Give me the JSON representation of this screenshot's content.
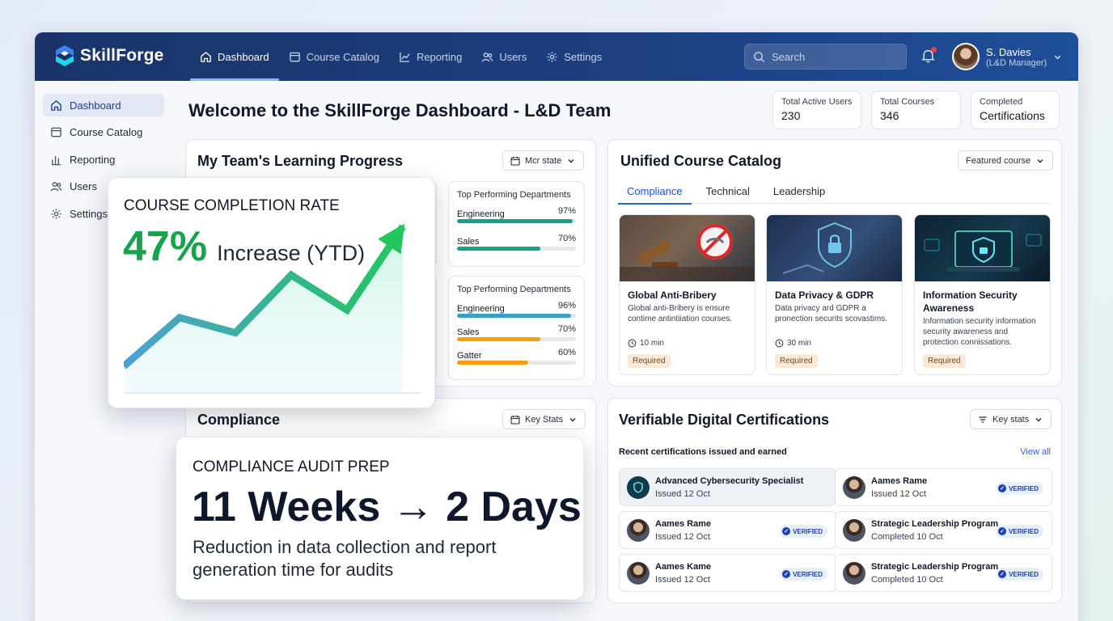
{
  "app": {
    "name": "SkillForge"
  },
  "nav": [
    {
      "label": "Dashboard",
      "icon": "home-icon"
    },
    {
      "label": "Course Catalog",
      "icon": "catalog-icon"
    },
    {
      "label": "Reporting",
      "icon": "chart-icon"
    },
    {
      "label": "Users",
      "icon": "users-icon"
    },
    {
      "label": "Settings",
      "icon": "gear-icon"
    }
  ],
  "search": {
    "placeholder": "Search"
  },
  "user": {
    "name": "S. Davies",
    "role": "(L&D Manager)"
  },
  "sidebar": [
    {
      "label": "Dashboard"
    },
    {
      "label": "Course Catalog"
    },
    {
      "label": "Reporting"
    },
    {
      "label": "Users"
    },
    {
      "label": "Settings"
    }
  ],
  "welcome": "Welcome to the SkillForge Dashboard - L&D Team",
  "stats": [
    {
      "label": "Total Active Users",
      "value": "230"
    },
    {
      "label": "Total Courses",
      "value": "346"
    },
    {
      "label": "Completed",
      "value": "Certifications"
    }
  ],
  "progress": {
    "title": "My Team's Learning Progress",
    "filter": "Mcr state",
    "panels": [
      {
        "title": "Top Performing Departments",
        "rows": [
          {
            "name": "Engineering",
            "pct": "97%",
            "value": 0.97,
            "color": "#14a089"
          },
          {
            "name": "Sales",
            "pct": "70%",
            "value": 0.7,
            "color": "#14a089"
          }
        ]
      },
      {
        "title": "Top Performing Departments",
        "rows": [
          {
            "name": "Engineering",
            "pct": "96%",
            "value": 0.96,
            "color": "#3b9fbf"
          },
          {
            "name": "Sales",
            "pct": "70%",
            "value": 0.7,
            "color": "#f59e0b"
          },
          {
            "name": "Gatter",
            "pct": "60%",
            "value": 0.6,
            "color": "#f59e0b"
          }
        ]
      }
    ]
  },
  "completion": {
    "heading": "COURSE COMPLETION RATE",
    "value": "47%",
    "label": "Increase (YTD)",
    "trend": [
      0.08,
      0.4,
      0.3,
      0.68,
      0.45,
      1.0
    ]
  },
  "compliance": {
    "title": "Compliance",
    "filter": "Key Stats"
  },
  "audit": {
    "heading": "COMPLIANCE AUDIT PREP",
    "headline": "11 Weeks → 2 Days",
    "desc": "Reduction in data collection and report generation time for audits"
  },
  "catalog": {
    "title": "Unified Course Catalog",
    "filter": "Featured course",
    "tabs": [
      "Compliance",
      "Technical",
      "Leadership"
    ],
    "courses": [
      {
        "title": "Global Anti-Bribery",
        "desc": "Global anti-Bribery is ensure contime antintiiation courses.",
        "duration": "10 min",
        "badge": "Required"
      },
      {
        "title": "Data Privacy & GDPR",
        "desc": "Data privacy ard GDPR a pronection securits scovastims.",
        "duration": "30 min",
        "badge": "Required"
      },
      {
        "title": "Information Security Awareness",
        "desc": "Information security information security awareness and protection connissations.",
        "duration": "",
        "badge": "Required"
      }
    ]
  },
  "certs": {
    "title": "Verifiable Digital Certifications",
    "filter": "Key stats",
    "subtitle": "Recent certifications issued and earned",
    "view_all": "View all",
    "verified_label": "VERIFIED",
    "items": [
      {
        "title": "Advanced Cybersecurity Specialist",
        "sub": "Issued 12 Oct",
        "verified": false
      },
      {
        "title": "Aames Rame",
        "sub": "Issued 12 Oct",
        "verified": true
      },
      {
        "title": "Aames Rame",
        "sub": "Issued 12 Oct",
        "verified": true
      },
      {
        "title": "Strategic Leadership Program",
        "sub": "Completed 10 Oct",
        "verified": true
      },
      {
        "title": "Aames Kame",
        "sub": "Issued 12 Oct",
        "verified": true
      },
      {
        "title": "Strategic Leadership Program",
        "sub": "Completed 10 Oct",
        "verified": true
      }
    ]
  },
  "colors": {
    "brand": "#1c3f80",
    "accent": "#2563eb",
    "success": "#16a34a"
  }
}
